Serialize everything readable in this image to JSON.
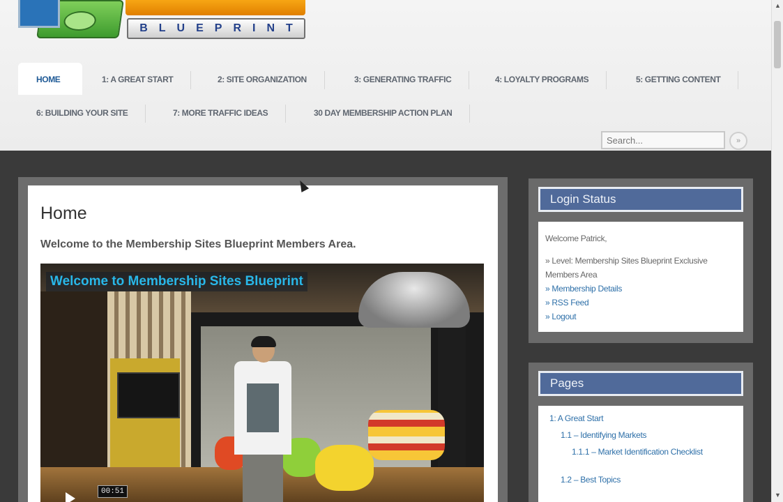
{
  "logo": {
    "word": "BLUEPRINT"
  },
  "nav": {
    "row1": [
      {
        "label": "HOME",
        "active": true
      },
      {
        "label": "1: A GREAT START"
      },
      {
        "label": "2: SITE ORGANIZATION"
      },
      {
        "label": "3: GENERATING TRAFFIC"
      },
      {
        "label": "4: LOYALTY PROGRAMS"
      },
      {
        "label": "5: GETTING CONTENT"
      }
    ],
    "row2": [
      {
        "label": "6: BUILDING YOUR SITE"
      },
      {
        "label": "7: MORE TRAFFIC IDEAS"
      },
      {
        "label": "30 DAY MEMBERSHIP ACTION PLAN"
      }
    ]
  },
  "search": {
    "placeholder": "Search...",
    "button": "»"
  },
  "main": {
    "title": "Home",
    "welcome": "Welcome to the Membership Sites Blueprint Members Area.",
    "video": {
      "overlay_title": "Welcome to Membership Sites Blueprint",
      "time": "00:51"
    }
  },
  "login_widget": {
    "title": "Login Status",
    "greeting": "Welcome Patrick,",
    "level": "» Level: Membership Sites Blueprint Exclusive Members Area",
    "links": [
      "» Membership Details",
      "» RSS Feed",
      "» Logout"
    ]
  },
  "pages_widget": {
    "title": "Pages",
    "items": [
      "1: A Great Start",
      "1.1 – Identifying Markets",
      "1.1.1 – Market Identification Checklist",
      "1.2 – Best Topics"
    ]
  },
  "colors": {
    "nav_active": "#1f5a96",
    "widget_header": "#506a9a",
    "link": "#2d6fa8",
    "video_overlay": "#29b7e8"
  }
}
